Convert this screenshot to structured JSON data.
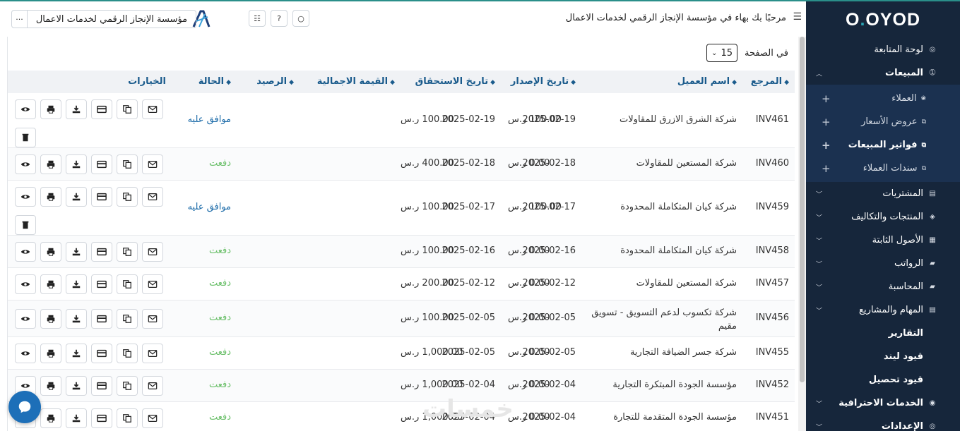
{
  "header": {
    "welcome": "مرحبًا بك بهاء في مؤسسة الإنجاز الرقمي لخدمات الاعمال",
    "company": "مؤسسة الإنجاز الرقمي لخدمات الاعمال",
    "more_label": "···"
  },
  "sidebar": {
    "logo_left": "O",
    "logo_dot": ".",
    "logo_right": "OYOD",
    "items": [
      {
        "label": "لوحة المتابعة",
        "icon": "dashboard-icon",
        "glyph": "◎"
      },
      {
        "label": "المبيعات",
        "icon": "sales-icon",
        "glyph": "➀",
        "expanded": true
      },
      {
        "label": "المشتريات",
        "icon": "purchases-icon",
        "glyph": "▤"
      },
      {
        "label": "المنتجات والتكاليف",
        "icon": "products-icon",
        "glyph": "◈"
      },
      {
        "label": "الأصول الثابتة",
        "icon": "assets-icon",
        "glyph": "▦"
      },
      {
        "label": "الرواتب",
        "icon": "payroll-icon",
        "glyph": "▰"
      },
      {
        "label": "المحاسبة",
        "icon": "accounting-icon",
        "glyph": "▰"
      },
      {
        "label": "المهام والمشاريع",
        "icon": "tasks-icon",
        "glyph": "▤"
      },
      {
        "label": "التقارير",
        "icon": "reports-icon",
        "glyph": ""
      },
      {
        "label": "قيود ليند",
        "icon": "journal-icon",
        "glyph": ""
      },
      {
        "label": "قيود تحصيل",
        "icon": "collection-icon",
        "glyph": ""
      },
      {
        "label": "الخدمات الاحترافية",
        "icon": "services-icon",
        "glyph": "◉"
      },
      {
        "label": "الإعدادات",
        "icon": "settings-icon",
        "glyph": "◎"
      }
    ],
    "sub_items": [
      {
        "label": "العملاء",
        "glyph": "❀"
      },
      {
        "label": "عروض الأسعار",
        "glyph": "⧉"
      },
      {
        "label": "فواتير المبيعات",
        "glyph": "⧉",
        "active": true
      },
      {
        "label": "سندات العملاء",
        "glyph": "⧉"
      }
    ]
  },
  "perpage": {
    "label": "في الصفحة",
    "value": "15"
  },
  "table": {
    "headers": {
      "ref": "المرجع",
      "client": "اسم العميل",
      "issue_date": "تاريخ الإصدار",
      "due_date": "تاريخ الاستحقاق",
      "total": "القيمة الاجمالية",
      "balance": "الرصيد",
      "status": "الحالة",
      "options": "الخيارات"
    },
    "rows": [
      {
        "ref": "INV461",
        "client": "شركة الشرق الازرق للمقاولات",
        "issue": "2025-02-19",
        "due": "2025-02-19",
        "total": "100.00 ر.س",
        "balance": "100.00 ر.س",
        "status": "موافق عليه",
        "approved": true
      },
      {
        "ref": "INV460",
        "client": "شركة المستعين للمقاولات",
        "issue": "2025-02-18",
        "due": "2025-02-18",
        "total": "400.00 ر.س",
        "balance": "0.00 ر.س",
        "status": "دفعت",
        "approved": false
      },
      {
        "ref": "INV459",
        "client": "شركة كيان المتكاملة المحدودة",
        "issue": "2025-02-17",
        "due": "2025-02-17",
        "total": "100.00 ر.س",
        "balance": "100.00 ر.س",
        "status": "موافق عليه",
        "approved": true
      },
      {
        "ref": "INV458",
        "client": "شركة كيان المتكاملة المحدودة",
        "issue": "2025-02-16",
        "due": "2025-02-16",
        "total": "100.00 ر.س",
        "balance": "0.00 ر.س",
        "status": "دفعت",
        "approved": false
      },
      {
        "ref": "INV457",
        "client": "شركة المستعين للمقاولات",
        "issue": "2025-02-12",
        "due": "2025-02-12",
        "total": "200.00 ر.س",
        "balance": "0.00 ر.س",
        "status": "دفعت",
        "approved": false
      },
      {
        "ref": "INV456",
        "client": "شركة تكسوب لدعم التسويق - تسويق مقيم",
        "issue": "2025-02-05",
        "due": "2025-02-05",
        "total": "100.00 ر.س",
        "balance": "0.00 ر.س",
        "status": "دفعت",
        "approved": false
      },
      {
        "ref": "INV455",
        "client": "شركة جسر الضيافة التجارية",
        "issue": "2025-02-05",
        "due": "2025-02-05",
        "total": "1,000.00 ر.س",
        "balance": "0.00 ر.س",
        "status": "دفعت",
        "approved": false
      },
      {
        "ref": "INV452",
        "client": "مؤسسة الجودة المبتكرة التجارية",
        "issue": "2025-02-04",
        "due": "2025-02-04",
        "total": "1,000.00 ر.س",
        "balance": "0.00 ر.س",
        "status": "دفعت",
        "approved": false
      },
      {
        "ref": "INV451",
        "client": "مؤسسة الجودة المتقدمة للتجارة",
        "issue": "2025-02-04",
        "due": "2025-02-04",
        "total": "1,000.00 ر.س",
        "balance": "0.00 ر.س",
        "status": "دفعت",
        "approved": false
      }
    ]
  },
  "watermark": "خمسات",
  "colors": {
    "sidebar": "#16263b",
    "accent": "#1a5b8c",
    "paid": "#6abf69",
    "approved": "#1a6aa8"
  }
}
